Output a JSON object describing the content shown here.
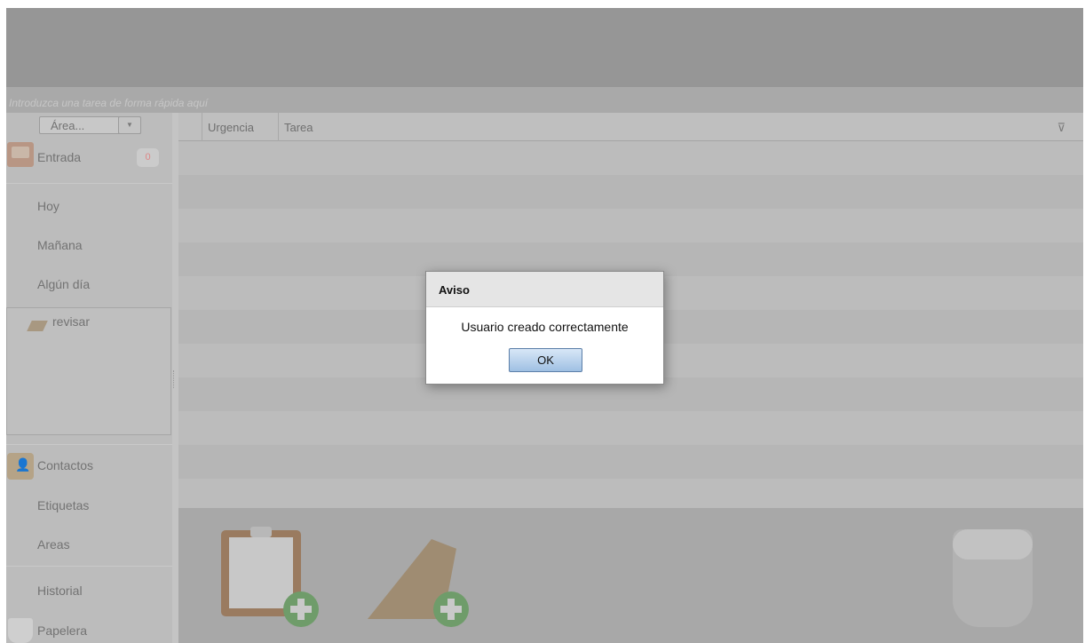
{
  "quick_entry": {
    "placeholder": "Introduzca una tarea de forma rápida aquí"
  },
  "sidebar": {
    "area_select": {
      "value": "Área..."
    },
    "inbox": {
      "label": "Entrada",
      "count": "0"
    },
    "schedule": [
      "Hoy",
      "Mañana",
      "Algún día"
    ],
    "projects": [
      {
        "label": "revisar"
      }
    ],
    "bottom": [
      "Contactos",
      "Etiquetas",
      "Areas",
      "Historial",
      "Papelera"
    ]
  },
  "table": {
    "columns": [
      "Urgencia",
      "Tarea"
    ],
    "filter_icon": "filter-icon",
    "rows": []
  },
  "dialog": {
    "title": "Aviso",
    "message": "Usuario creado correctamente",
    "ok_label": "OK"
  },
  "bottom_panel": {
    "icons": [
      "new-task-icon",
      "new-project-icon",
      "trash-icon"
    ]
  }
}
